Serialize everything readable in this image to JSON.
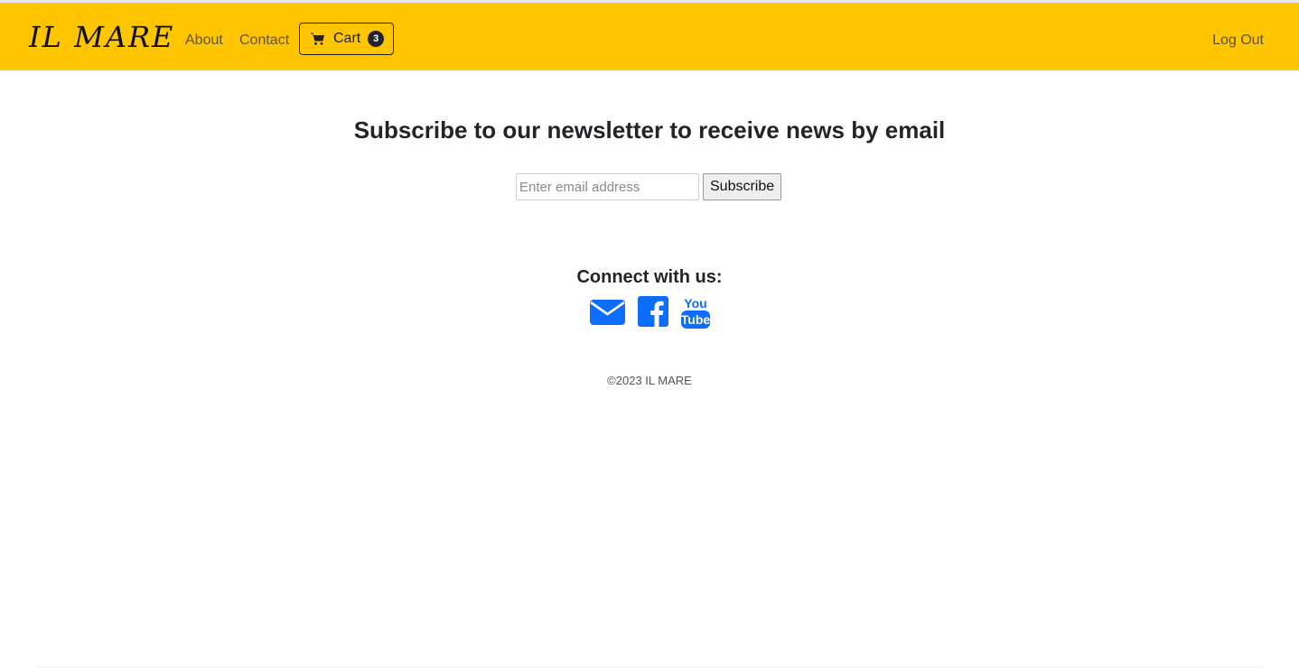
{
  "navbar": {
    "brand": "IL MARE",
    "links": [
      "About",
      "Contact"
    ],
    "cart": {
      "label": "Cart",
      "count": "3",
      "icon": "cart-icon"
    },
    "logout": "Log Out",
    "background": "#ffc600"
  },
  "newsletter": {
    "headline": "Subscribe to our newsletter to receive news by email",
    "email_placeholder": "Enter email address",
    "email_value": "",
    "button_label": "Subscribe"
  },
  "social": {
    "heading": "Connect with us:",
    "icons": [
      "envelope-icon",
      "facebook-icon",
      "youtube-icon"
    ],
    "icon_color": "#0d6efd"
  },
  "footer": {
    "copyright": "©2023 IL MARE"
  }
}
